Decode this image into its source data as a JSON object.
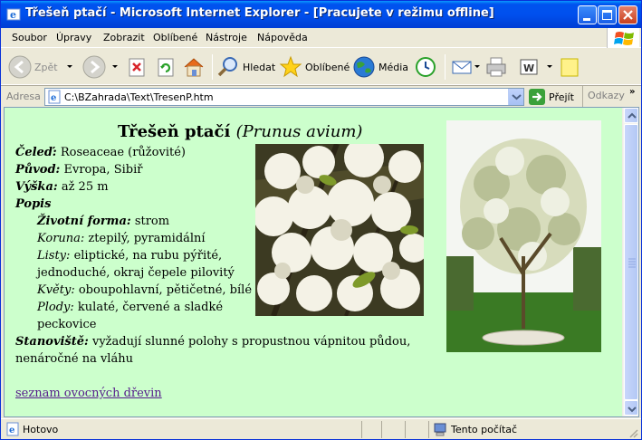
{
  "window": {
    "title": "Třešeň ptačí - Microsoft Internet Explorer - [Pracujete v režimu offline]"
  },
  "menu": {
    "items": [
      "Soubor",
      "Úpravy",
      "Zobrazit",
      "Oblíbené",
      "Nástroje",
      "Nápověda"
    ]
  },
  "toolbar": {
    "back_label": "Zpět",
    "search_label": "Hledat",
    "favorites_label": "Oblíbené",
    "media_label": "Média"
  },
  "address": {
    "label": "Adresa",
    "url": "C:\\BZahrada\\Text\\TresenP.htm",
    "go_label": "Přejít",
    "links_label": "Odkazy"
  },
  "page": {
    "heading": "Třešeň ptačí",
    "heading_latin": "(Prunus avium)",
    "family_key": "Čeleď:",
    "family_val": "Roseaceae (růžovité)",
    "origin_key": "Původ:",
    "origin_val": "Evropa, Sibiř",
    "height_key": "Výška:",
    "height_val": "až 25 m",
    "description_key": "Popis",
    "lifeform_key": "Životní forma:",
    "lifeform_val": "strom",
    "crown_key": "Koruna:",
    "crown_val": "ztepilý, pyramidální",
    "leaves_key": "Listy:",
    "leaves_val_1": "eliptické, na rubu pýřité,",
    "leaves_val_2": "jednoduché, okraj čepele pilovitý",
    "flowers_key": "Květy:",
    "flowers_val": "oboupohlavní, pětičetné, bílé",
    "fruits_key": "Plody:",
    "fruits_val_1": "kulaté, červené a sladké",
    "fruits_val_2": "peckovice",
    "habitat_key": "Stanoviště:",
    "habitat_val_1": "vyžadují slunné polohy s propustnou vápnitou půdou,",
    "habitat_val_2": "nenáročné na vláhu",
    "link_label": "seznam ovocných dřevin"
  },
  "status": {
    "text": "Hotovo",
    "zone": "Tento počítač"
  },
  "colors": {
    "page_background": "#ccffcc",
    "titlebar_blue": "#0053ee",
    "link_visited": "#551a8b"
  }
}
